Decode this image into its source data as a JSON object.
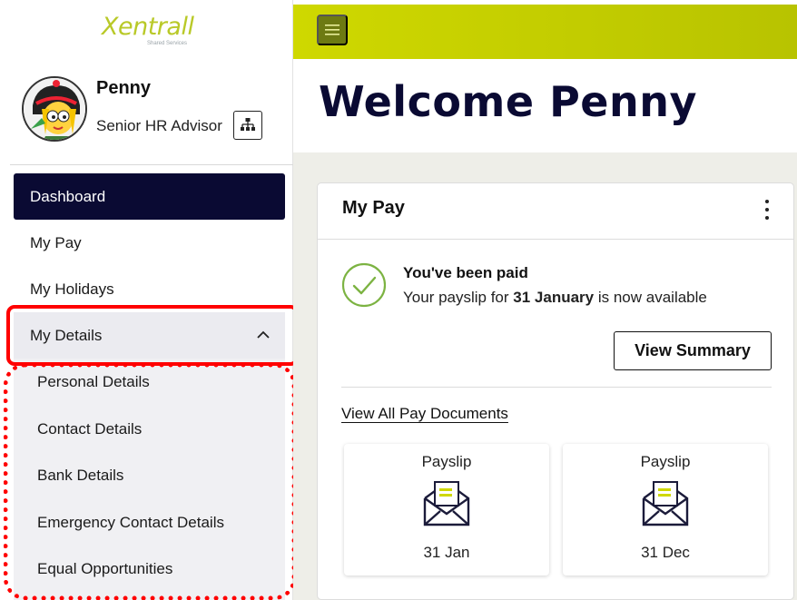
{
  "app": {
    "logo_text": "Xentrall",
    "logo_subtext": "Shared Services"
  },
  "user": {
    "name": "Penny",
    "role": "Senior HR Advisor"
  },
  "nav": {
    "items": [
      {
        "label": "Dashboard",
        "active": true
      },
      {
        "label": "My Pay"
      },
      {
        "label": "My Holidays"
      },
      {
        "label": "My Details",
        "expanded": true
      }
    ],
    "sub_items": [
      {
        "label": "Personal Details"
      },
      {
        "label": "Contact Details"
      },
      {
        "label": "Bank Details"
      },
      {
        "label": "Emergency Contact Details"
      },
      {
        "label": "Equal Opportunities"
      }
    ]
  },
  "header": {
    "welcome": "Welcome Penny"
  },
  "pay_card": {
    "title": "My Pay",
    "status_title": "You've been paid",
    "status_prefix": "Your payslip for ",
    "status_date": "31 January",
    "status_suffix": " is now available",
    "view_summary_label": "View Summary",
    "view_all_label": "View All Pay Documents",
    "documents": [
      {
        "label": "Payslip",
        "date": "31 Jan"
      },
      {
        "label": "Payslip",
        "date": "31 Dec"
      }
    ]
  },
  "colors": {
    "brand_lime": "#cfd800",
    "nav_active": "#0a0a33",
    "check_green": "#7cb342",
    "highlight_red": "#ff0000"
  }
}
